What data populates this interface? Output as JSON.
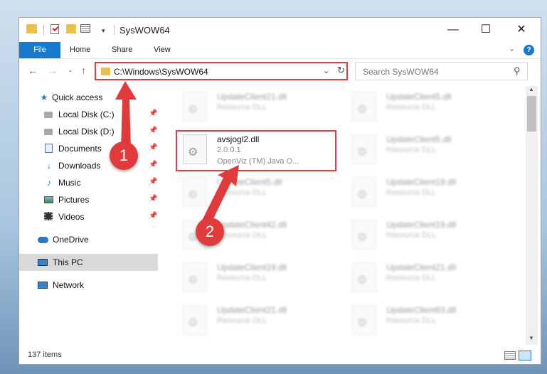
{
  "window": {
    "title": "SysWOW64"
  },
  "window_controls": {
    "minimize": "—",
    "maximize": "☐",
    "close": "✕"
  },
  "quick_access_toolbar": {
    "dropdown": "▾"
  },
  "ribbon": {
    "tabs": [
      {
        "label": "File",
        "active": true
      },
      {
        "label": "Home"
      },
      {
        "label": "Share"
      },
      {
        "label": "View"
      }
    ],
    "expand_chevron": "⌄",
    "help": "?"
  },
  "nav": {
    "back": "←",
    "forward": "→",
    "recent": "⌄",
    "up": "↑",
    "address": "C:\\Windows\\SysWOW64",
    "address_dropdown": "⌄",
    "refresh": "↻",
    "search_placeholder": "Search SysWOW64",
    "search_icon": "⚲"
  },
  "sidebar": {
    "items": [
      {
        "label": "Quick access",
        "icon": "star-icon"
      },
      {
        "label": "Local Disk (C:)",
        "icon": "disk-icon",
        "pinned": true
      },
      {
        "label": "Local Disk (D:)",
        "icon": "disk-icon",
        "pinned": true
      },
      {
        "label": "Documents",
        "icon": "documents-icon",
        "pinned": true
      },
      {
        "label": "Downloads",
        "icon": "download-icon",
        "pinned": true
      },
      {
        "label": "Music",
        "icon": "music-icon",
        "pinned": true
      },
      {
        "label": "Pictures",
        "icon": "pictures-icon",
        "pinned": true
      },
      {
        "label": "Videos",
        "icon": "videos-icon",
        "pinned": true
      },
      {
        "label": "OneDrive",
        "icon": "cloud-icon"
      },
      {
        "label": "This PC",
        "icon": "computer-icon",
        "selected": true
      },
      {
        "label": "Network",
        "icon": "network-icon"
      }
    ],
    "pin_glyph": "📌"
  },
  "files": [
    {
      "name": "UpdateClient21.dll",
      "type": "Resource DLL",
      "blurred": true
    },
    {
      "name": "UpdateClient5.dll",
      "type": "Resource DLL",
      "blurred": true
    },
    {
      "name": "avsjogl2.dll",
      "version": "2.0.0.1",
      "description": "OpenViz (TM) Java O...",
      "blurred": false
    },
    {
      "name": "UpdateClient5.dll",
      "type": "Resource DLL",
      "blurred": true
    },
    {
      "name": "UpdateClient5.dll",
      "type": "Resource DLL",
      "blurred": true
    },
    {
      "name": "UpdateClient19.dll",
      "type": "Resource DLL",
      "blurred": true
    },
    {
      "name": "UpdateClient42.dll",
      "type": "Resource DLL",
      "blurred": true
    },
    {
      "name": "UpdateClient19.dll",
      "type": "Resource DLL",
      "blurred": true
    },
    {
      "name": "UpdateClient19.dll",
      "type": "Resource DLL",
      "blurred": true
    },
    {
      "name": "UpdateClient21.dll",
      "type": "Resource DLL",
      "blurred": true
    },
    {
      "name": "UpdateClient21.dll",
      "type": "Resource DLL",
      "blurred": true
    },
    {
      "name": "UpdateClient63.dll",
      "type": "Resource DLL",
      "blurred": true
    }
  ],
  "status": {
    "item_count": "137 items"
  },
  "callouts": [
    {
      "number": "1"
    },
    {
      "number": "2"
    }
  ],
  "colors": {
    "accent": "#1979ca",
    "highlight": "#e03a3a",
    "folder": "#e8c04a"
  }
}
